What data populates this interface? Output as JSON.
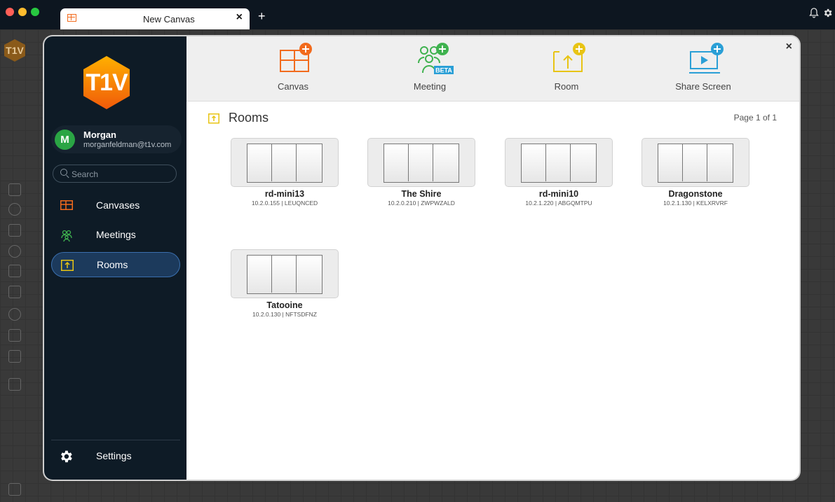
{
  "tab": {
    "title": "New Canvas",
    "close": "×",
    "add": "+"
  },
  "brand": {
    "logo_text": "T1V",
    "accent_orange": "#f26b1d",
    "accent_green": "#2aa544",
    "accent_yellow": "#e8c414",
    "accent_blue": "#2a9fd6",
    "sidebar_bg": "#0e1b26"
  },
  "user": {
    "initial": "M",
    "name": "Morgan",
    "email": "morganfeldman@t1v.com"
  },
  "search": {
    "placeholder": "Search"
  },
  "nav": {
    "items": [
      {
        "label": "Canvases",
        "icon": "canvas-icon"
      },
      {
        "label": "Meetings",
        "icon": "people-icon"
      },
      {
        "label": "Rooms",
        "icon": "room-share-icon",
        "active": true
      }
    ],
    "settings_label": "Settings"
  },
  "actions": [
    {
      "label": "Canvas",
      "icon": "canvas-add-icon"
    },
    {
      "label": "Meeting",
      "icon": "meeting-add-icon",
      "badge": "BETA"
    },
    {
      "label": "Room",
      "icon": "room-add-icon"
    },
    {
      "label": "Share Screen",
      "icon": "share-screen-add-icon"
    }
  ],
  "close_label": "×",
  "content": {
    "title": "Rooms",
    "page_info": "Page 1 of 1",
    "rooms": [
      {
        "name": "rd-mini13",
        "meta": "10.2.0.155 | LEUQNCED"
      },
      {
        "name": "The Shire",
        "meta": "10.2.0.210 | ZWPWZALD"
      },
      {
        "name": "rd-mini10",
        "meta": "10.2.1.220 | ABGQMTPU"
      },
      {
        "name": "Dragonstone",
        "meta": "10.2.1.130 | KELXRVRF"
      },
      {
        "name": "Tatooine",
        "meta": "10.2.0.130 | NFTSDFNZ"
      }
    ]
  }
}
